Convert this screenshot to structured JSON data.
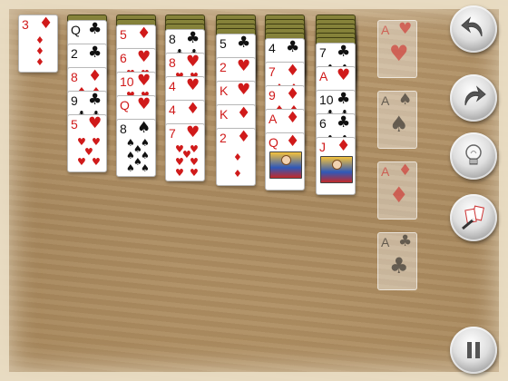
{
  "stock": {
    "card": {
      "rank": "3",
      "suit": "diamond",
      "glyph": "♦",
      "color": "red"
    }
  },
  "tableau": [
    {
      "down": 0,
      "cards": []
    },
    {
      "down": 1,
      "cards": [
        {
          "rank": "Q",
          "glyph": "♣",
          "color": "black"
        },
        {
          "rank": "2",
          "glyph": "♣",
          "color": "black"
        },
        {
          "rank": "8",
          "glyph": "♦",
          "color": "red"
        },
        {
          "rank": "9",
          "glyph": "♣",
          "color": "black"
        },
        {
          "rank": "5",
          "glyph": "♥",
          "color": "red"
        }
      ]
    },
    {
      "down": 2,
      "cards": [
        {
          "rank": "5",
          "glyph": "♦",
          "color": "red"
        },
        {
          "rank": "6",
          "glyph": "♥",
          "color": "red"
        },
        {
          "rank": "10",
          "glyph": "♥",
          "color": "red"
        },
        {
          "rank": "Q",
          "glyph": "♥",
          "color": "red"
        },
        {
          "rank": "8",
          "glyph": "♠",
          "color": "black"
        }
      ]
    },
    {
      "down": 3,
      "cards": [
        {
          "rank": "8",
          "glyph": "♣",
          "color": "black"
        },
        {
          "rank": "8",
          "glyph": "♥",
          "color": "red"
        },
        {
          "rank": "4",
          "glyph": "♥",
          "color": "red"
        },
        {
          "rank": "4",
          "glyph": "♦",
          "color": "red"
        },
        {
          "rank": "7",
          "glyph": "♥",
          "color": "red"
        }
      ]
    },
    {
      "down": 4,
      "cards": [
        {
          "rank": "5",
          "glyph": "♣",
          "color": "black"
        },
        {
          "rank": "2",
          "glyph": "♥",
          "color": "red"
        },
        {
          "rank": "K",
          "glyph": "♥",
          "color": "red"
        },
        {
          "rank": "K",
          "glyph": "♦",
          "color": "red"
        },
        {
          "rank": "2",
          "glyph": "♦",
          "color": "red"
        }
      ]
    },
    {
      "down": 5,
      "cards": [
        {
          "rank": "4",
          "glyph": "♣",
          "color": "black"
        },
        {
          "rank": "7",
          "glyph": "♦",
          "color": "red"
        },
        {
          "rank": "9",
          "glyph": "♦",
          "color": "red"
        },
        {
          "rank": "A",
          "glyph": "♦",
          "color": "red"
        },
        {
          "rank": "Q",
          "glyph": "♦",
          "color": "red",
          "face": true
        }
      ]
    },
    {
      "down": 6,
      "cards": [
        {
          "rank": "7",
          "glyph": "♣",
          "color": "black"
        },
        {
          "rank": "A",
          "glyph": "♥",
          "color": "red"
        },
        {
          "rank": "10",
          "glyph": "♣",
          "color": "black"
        },
        {
          "rank": "6",
          "glyph": "♣",
          "color": "black"
        },
        {
          "rank": "J",
          "glyph": "♦",
          "color": "red",
          "face": true
        }
      ]
    }
  ],
  "foundations": [
    {
      "rank": "A",
      "glyph": "♥",
      "color": "red"
    },
    {
      "rank": "A",
      "glyph": "♠",
      "color": "black"
    },
    {
      "rank": "A",
      "glyph": "♦",
      "color": "red"
    },
    {
      "rank": "A",
      "glyph": "♣",
      "color": "black"
    }
  ],
  "controls": [
    {
      "name": "undo-button",
      "icon": "undo-arrow-icon"
    },
    {
      "name": "redo-button",
      "icon": "redo-arrow-icon"
    },
    {
      "name": "hint-button",
      "icon": "lightbulb-icon"
    },
    {
      "name": "auto-play-button",
      "icon": "magic-wand-icon"
    },
    {
      "name": "pause-button",
      "icon": "pause-icon"
    }
  ]
}
